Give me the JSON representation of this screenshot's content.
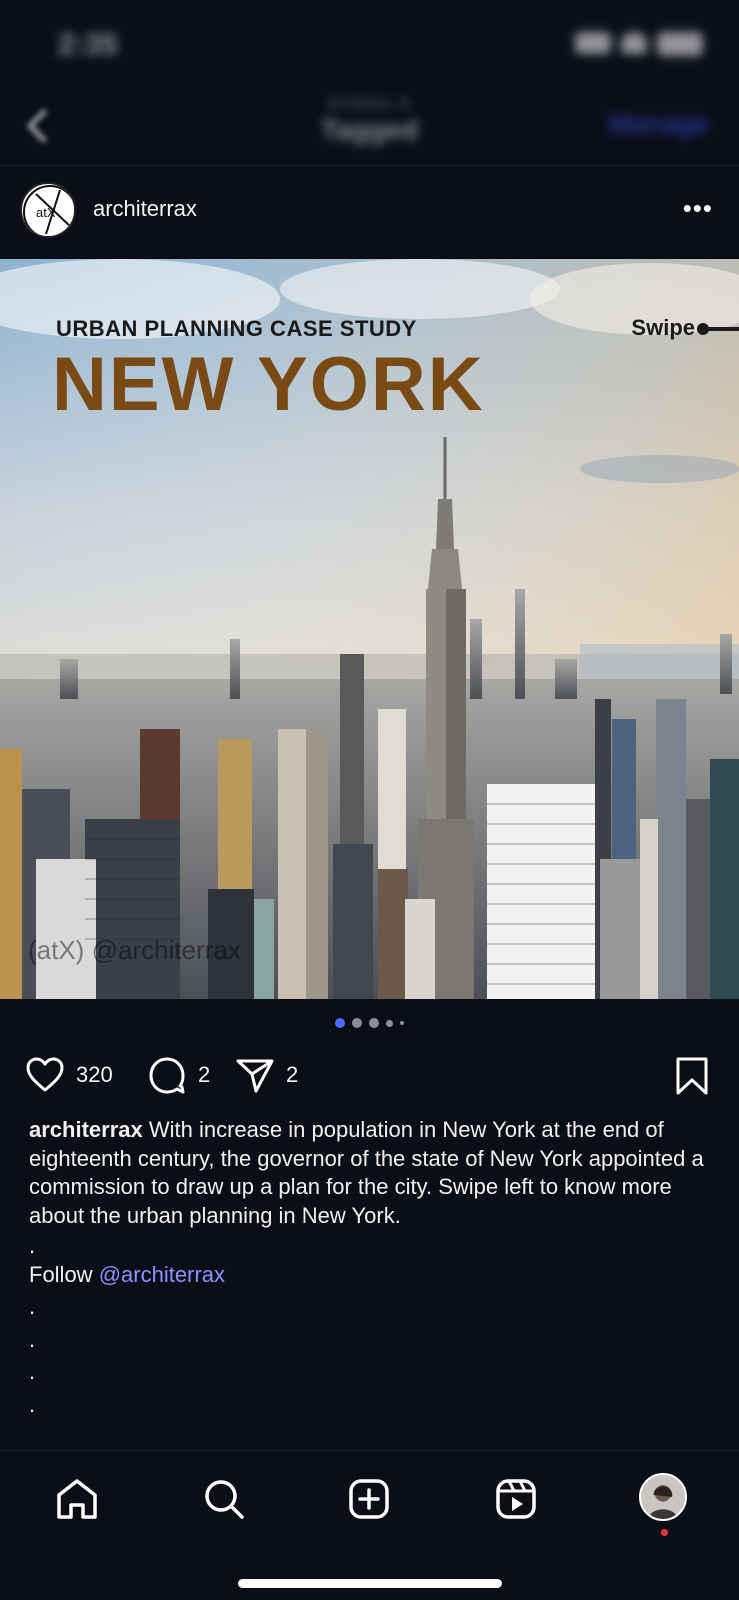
{
  "status_bar": {
    "time": "2:35"
  },
  "header": {
    "subtitle": "SYDHA.S",
    "title": "Tagged",
    "manage_label": "Manage"
  },
  "post": {
    "username": "architerrax",
    "avatar_text": "atX",
    "more_label": "•••",
    "image": {
      "kicker": "URBAN PLANNING CASE STUDY",
      "title": "NEW YORK",
      "swipe": "Swipe",
      "watermark": "(atX) @architerrax"
    },
    "carousel": {
      "count": 5,
      "active_index": 0
    },
    "likes": "320",
    "comments": "2",
    "shares": "2",
    "caption": {
      "username": "architerrax",
      "text": "With increase in population in New York at the end of eighteenth century, the governor of the state of New York appointed a commission to draw up a plan for the city. Swipe left to know more about the urban planning in New York.",
      "dot1": ".",
      "follow_prefix": "Follow ",
      "mention": "@architerrax",
      "dot2": ".",
      "dot3": ".",
      "dot4": ".",
      "dot5": "."
    }
  },
  "colors": {
    "background": "#0b0e17",
    "accent": "#3d5cff",
    "mention": "#8b91ff",
    "title_brown": "#7a4a14",
    "notification": "#ff2d3f"
  },
  "tabbar": {
    "icons": [
      "home-icon",
      "search-icon",
      "create-icon",
      "reels-icon",
      "profile-avatar"
    ]
  }
}
